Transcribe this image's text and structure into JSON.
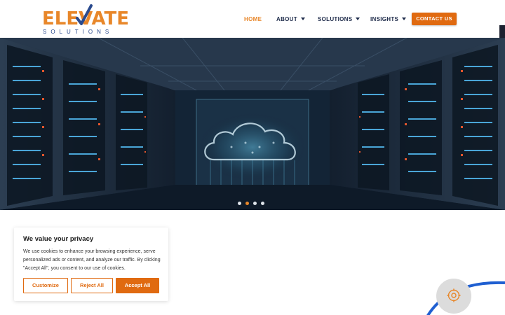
{
  "brand": {
    "logo_word": "ELEVATE",
    "logo_sub": "SOLUTIONS",
    "primary_color": "#e8872a",
    "secondary_color": "#2a4a8e"
  },
  "nav": {
    "items": [
      {
        "label": "HOME",
        "active": true
      },
      {
        "label": "ABOUT",
        "has_dropdown": true
      },
      {
        "label": "SOLUTIONS",
        "has_dropdown": true
      },
      {
        "label": "INSIGHTS",
        "has_dropdown": true
      }
    ],
    "cta_label": "CONTACT US",
    "cta_color": "#e06a10"
  },
  "hero": {
    "image": "data-center-cloud",
    "slides": 4,
    "active_slide": 2
  },
  "cookie": {
    "title": "We value your privacy",
    "text": "We use cookies to enhance your browsing experience, serve personalized ads or content, and analyze our traffic. By clicking \"Accept All\", you consent to our use of cookies.",
    "customize_label": "Customize",
    "reject_label": "Reject All",
    "accept_label": "Accept All"
  },
  "widget": {
    "icon": "cookie-settings-icon",
    "accent_color": "#1f5fd1"
  }
}
